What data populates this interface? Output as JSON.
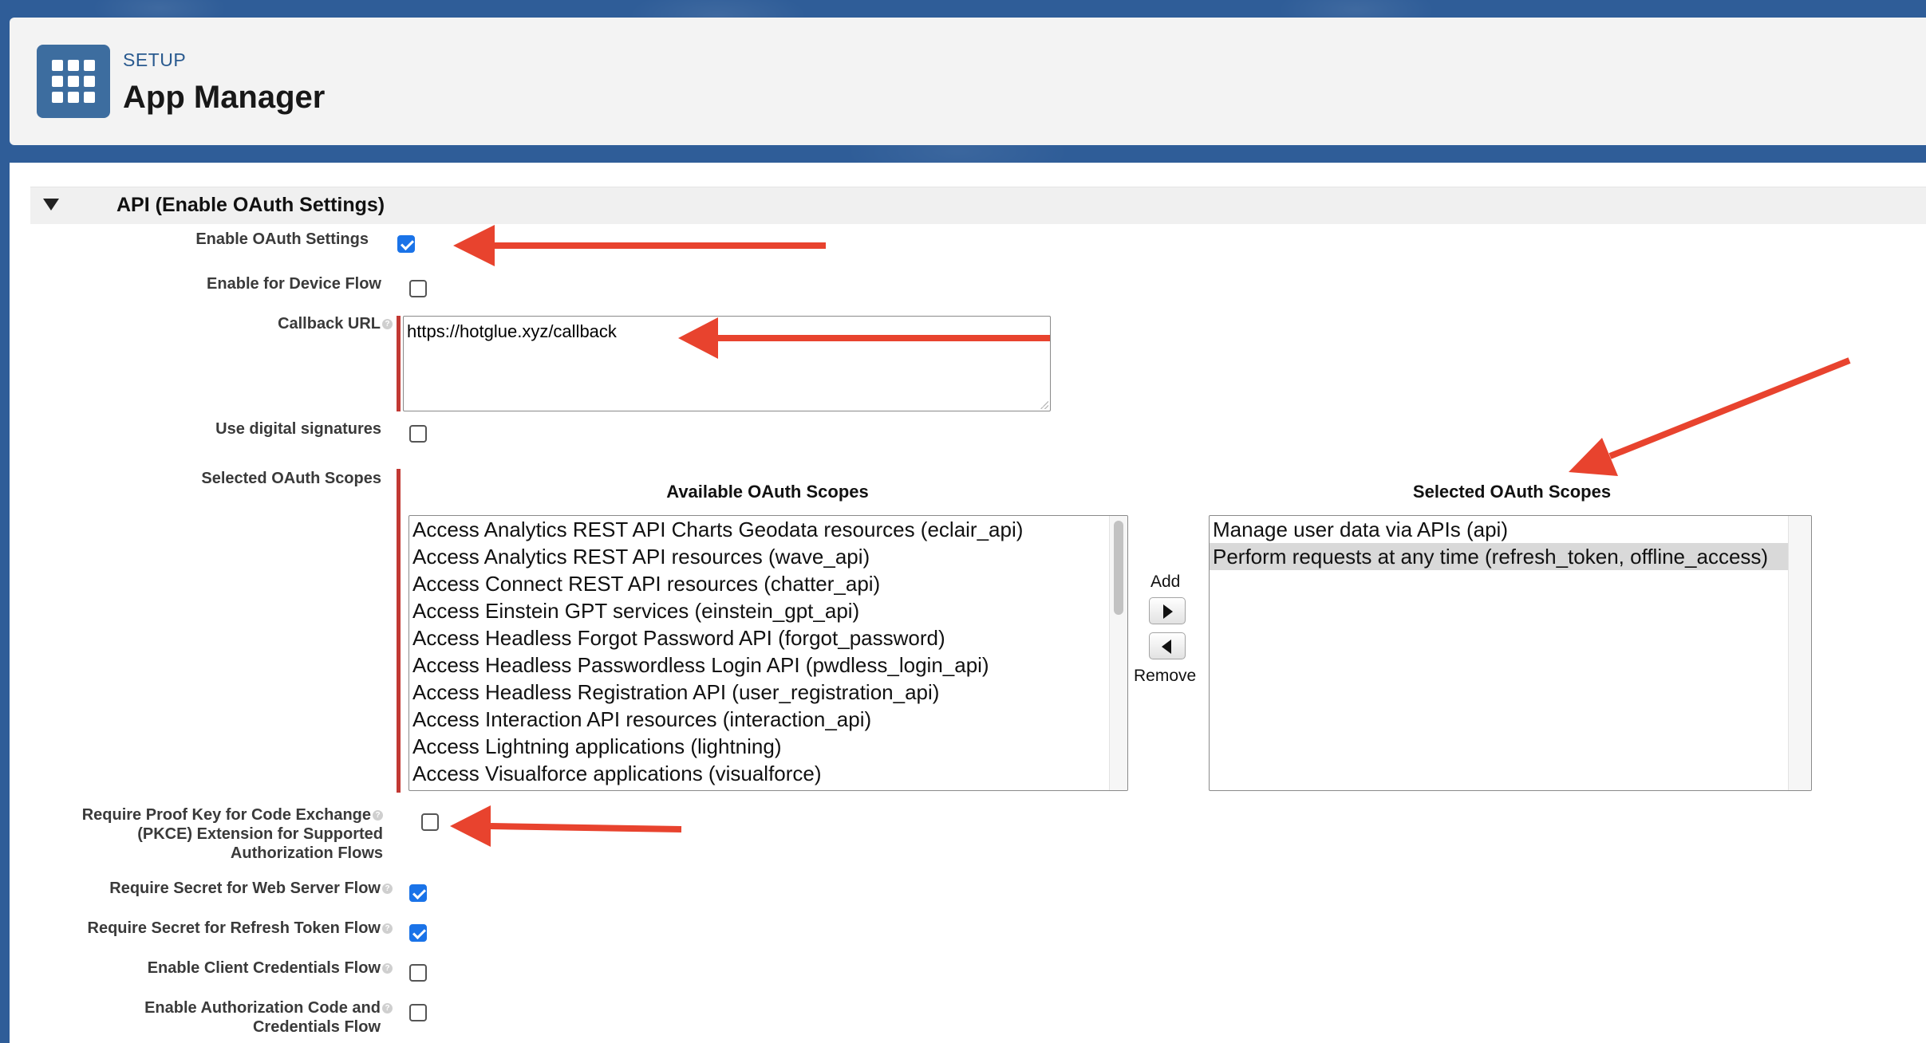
{
  "header": {
    "eyebrow": "SETUP",
    "title": "App Manager",
    "icon": "app-grid-icon"
  },
  "section": {
    "title": "API (Enable OAuth Settings)",
    "toggle_icon": "collapse-triangle-icon"
  },
  "fields": {
    "enable_oauth": {
      "label": "Enable OAuth Settings",
      "checked": true
    },
    "device_flow": {
      "label": "Enable for Device Flow",
      "checked": false
    },
    "callback_url": {
      "label": "Callback URL",
      "value": "https://hotglue.xyz/callback"
    },
    "digital_signatures": {
      "label": "Use digital signatures",
      "checked": false
    },
    "oauth_scopes": {
      "label": "Selected OAuth Scopes"
    },
    "pkce": {
      "label_lines": [
        "Require Proof Key for Code Exchange",
        "(PKCE) Extension for Supported",
        "Authorization Flows"
      ],
      "checked": false
    },
    "secret_web_server": {
      "label": "Require Secret for Web Server Flow",
      "checked": true
    },
    "secret_refresh": {
      "label": "Require Secret for Refresh Token Flow",
      "checked": true
    },
    "client_credentials": {
      "label": "Enable Client Credentials Flow",
      "checked": false
    },
    "auth_code": {
      "label_lines": [
        "Enable Authorization Code and",
        "Credentials Flow"
      ],
      "checked": false
    }
  },
  "scopes": {
    "available_header": "Available OAuth Scopes",
    "selected_header": "Selected OAuth Scopes",
    "available": [
      "Access Analytics REST API Charts Geodata resources (eclair_api)",
      "Access Analytics REST API resources (wave_api)",
      "Access Connect REST API resources (chatter_api)",
      "Access Einstein GPT services (einstein_gpt_api)",
      "Access Headless Forgot Password API (forgot_password)",
      "Access Headless Passwordless Login API (pwdless_login_api)",
      "Access Headless Registration API (user_registration_api)",
      "Access Interaction API resources (interaction_api)",
      "Access Lightning applications (lightning)",
      "Access Visualforce applications (visualforce)"
    ],
    "selected": [
      "Manage user data via APIs (api)",
      "Perform requests at any time (refresh_token, offline_access)"
    ],
    "add_label": "Add",
    "remove_label": "Remove"
  },
  "colors": {
    "accent_check": "#1a73e8",
    "required_bar": "#c23934",
    "annotation_arrow": "#e8432e"
  }
}
